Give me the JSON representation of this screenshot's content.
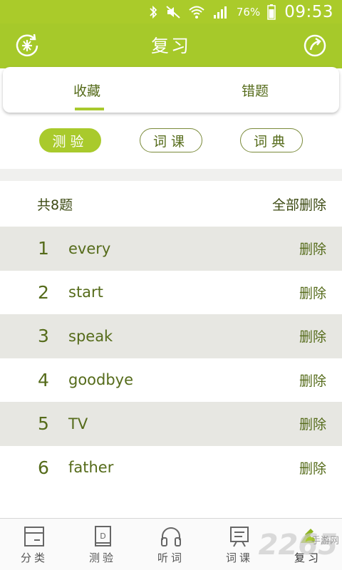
{
  "status_bar": {
    "battery": "76%",
    "time": "09:53"
  },
  "header": {
    "title": "复习",
    "left_icon": "rice-icon",
    "right_icon": "share-icon"
  },
  "segments": [
    {
      "label": "收藏",
      "active": true
    },
    {
      "label": "错题",
      "active": false
    }
  ],
  "filters": [
    {
      "label": "测验",
      "active": true
    },
    {
      "label": "词课",
      "active": false
    },
    {
      "label": "词典",
      "active": false
    }
  ],
  "summary": {
    "count_text": "共8题",
    "delete_all": "全部删除"
  },
  "items": [
    {
      "num": "1",
      "word": "every",
      "action": "删除"
    },
    {
      "num": "2",
      "word": "start",
      "action": "删除"
    },
    {
      "num": "3",
      "word": "speak",
      "action": "删除"
    },
    {
      "num": "4",
      "word": "goodbye",
      "action": "删除"
    },
    {
      "num": "5",
      "word": "TV",
      "action": "删除"
    },
    {
      "num": "6",
      "word": "father",
      "action": "删除"
    }
  ],
  "bottom_nav": [
    {
      "label": "分类",
      "icon": "category-icon"
    },
    {
      "label": "测验",
      "icon": "quiz-book-icon"
    },
    {
      "label": "听词",
      "icon": "headphones-icon"
    },
    {
      "label": "词课",
      "icon": "lesson-icon"
    },
    {
      "label": "复习",
      "icon": "review-icon",
      "active": true
    }
  ],
  "watermark": {
    "big": "2265",
    "small": "手游网"
  },
  "colors": {
    "accent": "#a8c92d",
    "text": "#556b1a",
    "row_shade": "#e7e7e2"
  }
}
